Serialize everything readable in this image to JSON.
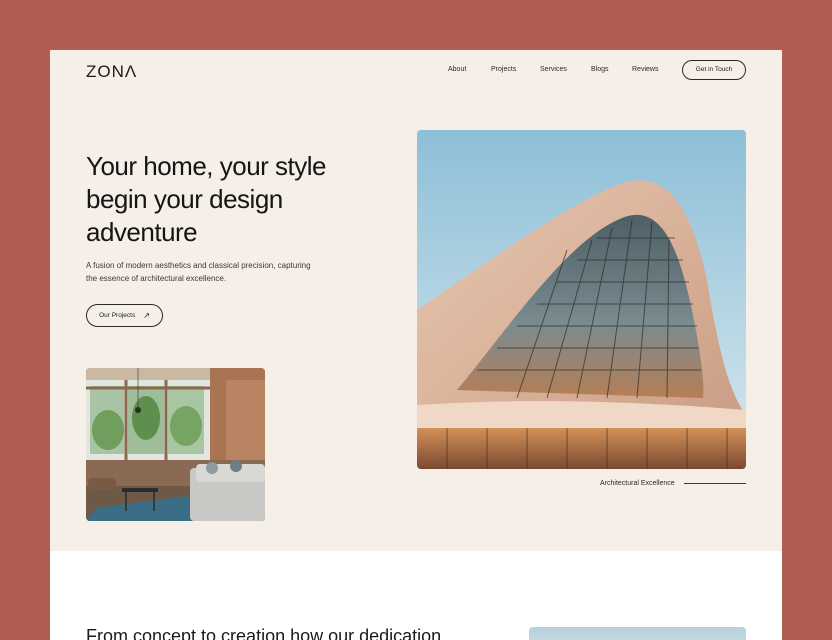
{
  "header": {
    "logo": "ZONΛ",
    "nav": [
      "About",
      "Projects",
      "Services",
      "Blogs",
      "Reviews"
    ],
    "cta": "Get in Touch"
  },
  "hero": {
    "headline_lines": [
      "Your home, your style",
      "begin your design",
      "adventure"
    ],
    "subtitle_lines": [
      "A fusion of modern aesthetics and classical precision, capturing",
      "the essence of architectural excellence."
    ],
    "button_label": "Our Projects",
    "caption": "Architectural Excellence"
  },
  "section2": {
    "title": "From concept to creation how our dedication"
  },
  "colors": {
    "frame": "#b05e52",
    "hero_bg": "#f5efe7",
    "text": "#1a1a1a"
  },
  "icons": {
    "button_arrow": "arrow-up-right-icon"
  }
}
